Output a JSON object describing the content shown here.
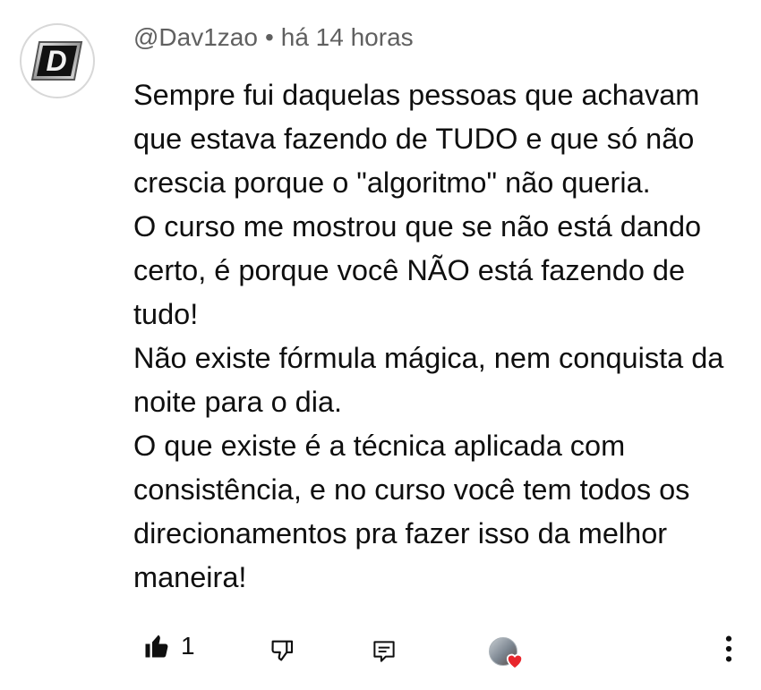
{
  "comment": {
    "author": "@Dav1zao",
    "separator": "•",
    "time_ago": "há 14 horas",
    "paragraphs": [
      "Sempre fui daquelas pessoas que achavam que estava fazendo de TUDO e que só não crescia porque o \"algoritmo\" não queria.",
      "O curso me mostrou que se não está dando certo, é porque você NÃO está fazendo de tudo!",
      "Não existe fórmula mágica, nem conquista da noite para o dia.",
      "O que existe é a técnica aplicada com consistência, e no curso você tem todos os direcionamentos pra fazer isso da melhor maneira!"
    ],
    "avatar_letter": "D"
  },
  "actions": {
    "like_count": "1",
    "icons": {
      "like": "thumbs-up-filled-icon",
      "dislike": "thumbs-down-icon",
      "reply": "reply-comment-icon",
      "creator_heart": "creator-heart-icon",
      "more": "more-vert-icon"
    }
  },
  "colors": {
    "text": "#0f0f0f",
    "meta": "#606060",
    "heart": "#e8262c"
  }
}
